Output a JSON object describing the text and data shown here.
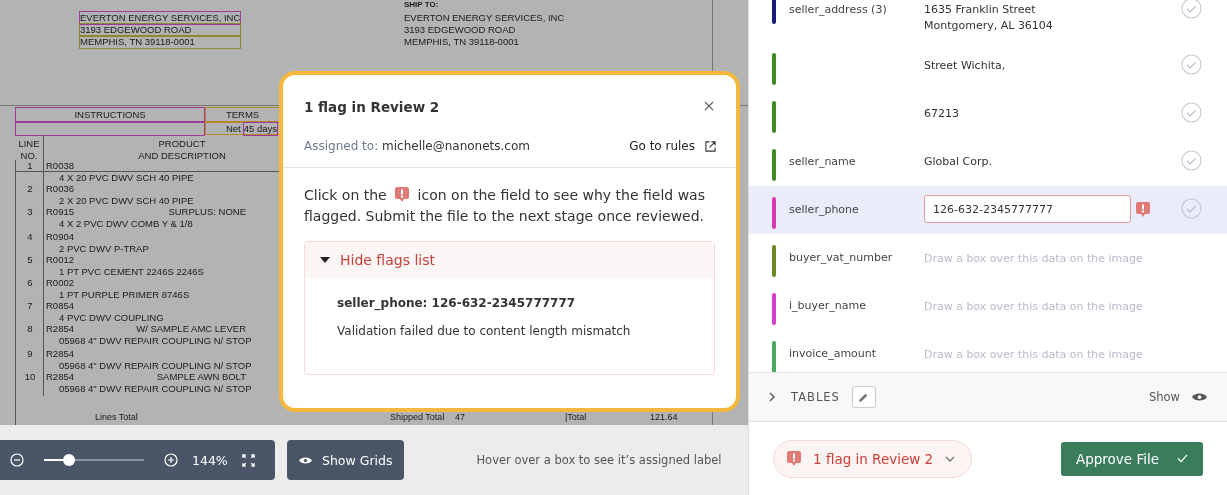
{
  "document": {
    "ship_to_label": "SHIP TO:",
    "bill_to": [
      "EVERTON  ENERGY SERVICES, INC",
      "3193  EDGEWOOD ROAD",
      "MEMPHIS, TN 39118-0001"
    ],
    "ship_to": [
      "EVERTON  ENERGY SERVICES, INC",
      "3193  EDGEWOOD ROAD",
      "MEMPHIS, TN 39118-0001"
    ],
    "instructions_header": "INSTRUCTIONS",
    "terms_header": "TERMS",
    "terms_prefix": "Net",
    "terms_value": "45 days",
    "line_header": [
      "LINE",
      "NO."
    ],
    "product_header": [
      "PRODUCT",
      "AND DESCRIPTION"
    ],
    "items": [
      {
        "no": "1",
        "code": "R0038",
        "description": "4 X 20 PVC DWV SCH 40 PIPE"
      },
      {
        "no": "2",
        "code": "R0036",
        "description": "2 X 20 PVC DWV SCH 40 PIPE"
      },
      {
        "no": "3",
        "code": "R0915",
        "note": "SURPLUS: NONE",
        "description": "4 X 2 PVC DWV COMB Y & 1/8"
      },
      {
        "no": "4",
        "code": "R0904",
        "description": "2 PVC DWV P-TRAP"
      },
      {
        "no": "5",
        "code": "R0012",
        "description": "1 PT PVC CEMENT 2246S 2246S"
      },
      {
        "no": "6",
        "code": "R0002",
        "description": "1 PT PURPLE PRIMER 8746S"
      },
      {
        "no": "7",
        "code": "R0854",
        "description": "4 PVC DWV COUPLING"
      },
      {
        "no": "8",
        "code": "R2854",
        "note": "W/ SAMPLE AMC LEVER",
        "description": "05968 4\" DWV REPAIR COUPLING N/ STOP"
      },
      {
        "no": "9",
        "code": "R2854",
        "description": "05968 4\" DWV REPAIR COUPLING N/ STOP"
      },
      {
        "no": "10",
        "code": "R2854",
        "note": "SAMPLE AWN BOLT",
        "description": "05968 4\" DWV REPAIR COUPLING N/ STOP"
      }
    ],
    "totals": [
      "Lines Total",
      "Shipped Total",
      "47",
      "|Total",
      "121.64"
    ]
  },
  "toolbar": {
    "level": 0.25,
    "zoom": "144%",
    "show_grids": "Show Grids",
    "hint": "Hover over a box to see it’s assigned label"
  },
  "popup": {
    "title": "1 flag in Review 2",
    "assigned_label": "Assigned to:",
    "assignee": "michelle@nanonets.com",
    "go_to_rules": "Go to rules",
    "message_before": "Click on the",
    "message_after": "icon on the field to see why the field was flagged. Submit the file to the next stage once reviewed.",
    "flags_toggle": "Hide flags list",
    "expanded": true,
    "flags": [
      {
        "field": "seller_phone: 126-632-2345777777",
        "reason": "Validation failed due to content length mismatch"
      }
    ]
  },
  "fields": [
    {
      "kind": "value",
      "label": "seller_address (3)",
      "lines": [
        "1635 Franklin Street",
        "Montgomery, AL 36104"
      ],
      "color": "#1a1a7a",
      "selected": false,
      "flagged": false
    },
    {
      "kind": "value",
      "lines": [
        "Street Wichita,"
      ],
      "color": "#3f8a23",
      "selected": false,
      "flagged": false
    },
    {
      "kind": "value",
      "lines": [
        "67213"
      ],
      "color": "#3f8a23",
      "selected": false,
      "flagged": false
    },
    {
      "kind": "value",
      "label": "seller_name",
      "lines": [
        "Global Corp."
      ],
      "color": "#3f8a23",
      "selected": false,
      "flagged": false
    },
    {
      "kind": "input",
      "label": "seller_phone",
      "value": "126-632-2345777777",
      "color": "#d63cb0",
      "selected": true,
      "flagged": true
    },
    {
      "kind": "empty",
      "label": "buyer_vat_number",
      "placeholder": "Draw a box over this data on the image",
      "color": "#6b8a23",
      "selected": false,
      "flagged": false
    },
    {
      "kind": "empty",
      "label": "i_buyer_name",
      "placeholder": "Draw a box over this data on the image",
      "color": "#d63cc8",
      "selected": false,
      "flagged": false
    },
    {
      "kind": "empty",
      "label": "invoice_amount",
      "placeholder": "Draw a box over this data on the image",
      "color": "#4aa860",
      "selected": false,
      "flagged": false
    }
  ],
  "tables": {
    "label": "TABLES",
    "show": "Show"
  },
  "footer": {
    "flags_button": "1 flag in Review 2",
    "approve": "Approve File"
  }
}
